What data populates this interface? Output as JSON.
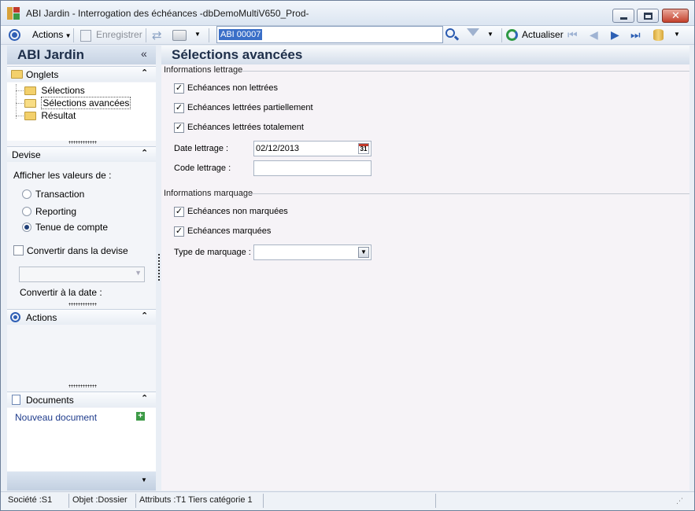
{
  "window": {
    "title": "ABI Jardin -  Interrogation des échéances -dbDemoMultiV650_Prod-"
  },
  "toolbar": {
    "actions_label": "Actions",
    "save_label": "Enregistrer",
    "search_value": "ABI 00007",
    "refresh_label": "Actualiser"
  },
  "sidebar": {
    "title": "ABI Jardin",
    "onglets": {
      "title": "Onglets",
      "items": [
        {
          "label": "Sélections"
        },
        {
          "label": "Sélections avancées"
        },
        {
          "label": "Résultat"
        }
      ]
    },
    "devise": {
      "title": "Devise",
      "show_values_label": "Afficher les valeurs de :",
      "options": [
        {
          "label": "Transaction",
          "selected": false
        },
        {
          "label": "Reporting",
          "selected": false
        },
        {
          "label": "Tenue de compte",
          "selected": true
        }
      ],
      "convert_label": "Convertir dans la devise",
      "convert_checked": false,
      "convert_date_label": "Convertir à la date :"
    },
    "actions": {
      "title": "Actions"
    },
    "documents": {
      "title": "Documents",
      "new_document_label": "Nouveau document"
    }
  },
  "main": {
    "title": "Sélections avancées",
    "lettrage": {
      "group_label": "Informations lettrage",
      "checks": [
        {
          "label": "Echéances non lettrées",
          "checked": true
        },
        {
          "label": "Echéances lettrées partiellement",
          "checked": true
        },
        {
          "label": "Echéances lettrées totalement",
          "checked": true
        }
      ],
      "date_label": "Date lettrage :",
      "date_value": "02/12/2013",
      "calendar_day": "31",
      "code_label": "Code lettrage :",
      "code_value": ""
    },
    "marquage": {
      "group_label": "Informations marquage",
      "checks": [
        {
          "label": "Echéances non marquées",
          "checked": true
        },
        {
          "label": "Echéances marquées",
          "checked": true
        }
      ],
      "type_label": "Type de marquage :",
      "type_value": ""
    }
  },
  "statusbar": {
    "societe": "Société :S1",
    "objet": "Objet :Dossier",
    "attributs": "Attributs :T1 Tiers catégorie 1"
  }
}
